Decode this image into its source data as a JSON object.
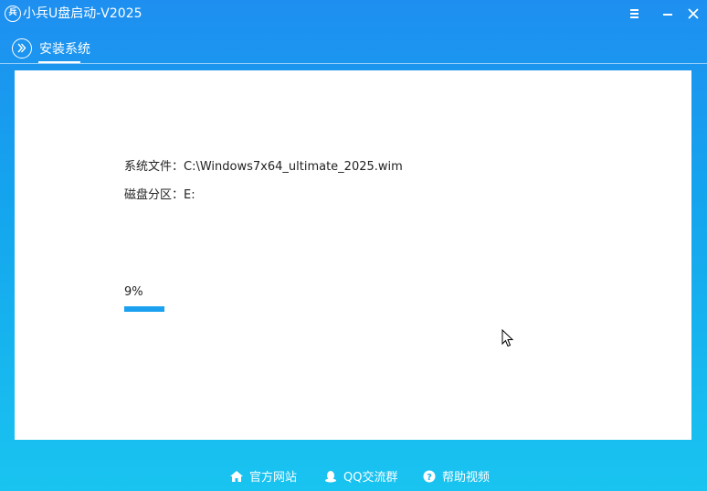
{
  "app": {
    "logo_text": "兵",
    "title": "小兵U盘启动-V2025"
  },
  "tab": {
    "label": "安装系统"
  },
  "install": {
    "file_label": "系统文件：",
    "file_value": "C:\\Windows7x64_ultimate_2025.wim",
    "partition_label": "磁盘分区：",
    "partition_value": "E:",
    "progress_text": "9%",
    "progress_fraction": 0.09
  },
  "footer": {
    "site": "官方网站",
    "qq": "QQ交流群",
    "help": "帮助视频"
  },
  "icons": {
    "menu": "menu-icon",
    "minimize": "minimize-icon",
    "close": "close-icon",
    "tab": "chevron-right-icon",
    "site": "home-icon",
    "qq": "qq-penguin-icon",
    "help": "help-icon"
  },
  "colors": {
    "accent": "#1ba1f0",
    "titlebar_top": "#1e8ff0",
    "footer_bottom": "#19c4f0"
  }
}
